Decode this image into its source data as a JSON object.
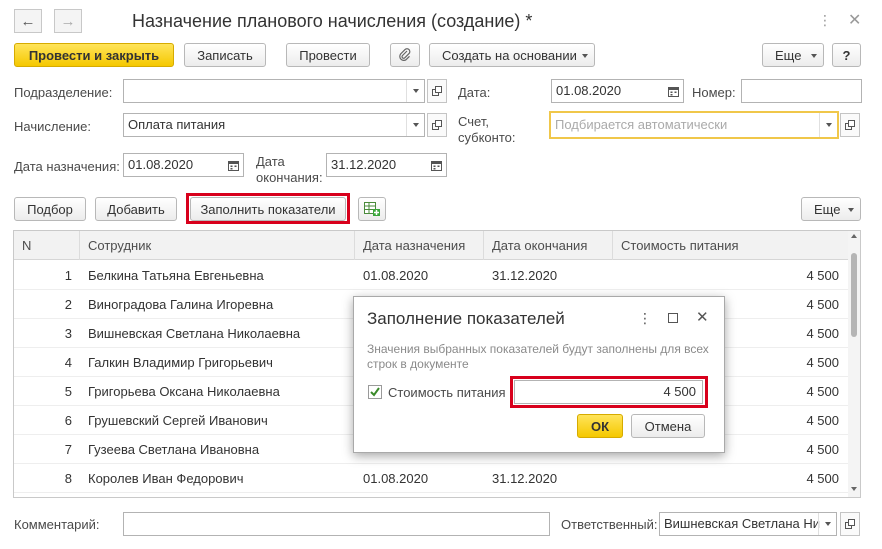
{
  "window": {
    "title": "Назначение планового начисления (создание) *"
  },
  "toolbar": {
    "post_close": "Провести и закрыть",
    "save": "Записать",
    "post": "Провести",
    "create_based": "Создать на основании",
    "more": "Еще",
    "help": "?"
  },
  "form": {
    "department_label": "Подразделение:",
    "department_value": "",
    "date_label": "Дата:",
    "date_value": "01.08.2020",
    "number_label": "Номер:",
    "number_value": "",
    "accrual_label": "Начисление:",
    "accrual_value": "Оплата питания",
    "account_label_1": "Счет,",
    "account_label_2": "субконто:",
    "account_placeholder": "Подбирается автоматически",
    "assign_date_label": "Дата назначения:",
    "assign_date_value": "01.08.2020",
    "end_date_label_1": "Дата",
    "end_date_label_2": "окончания:",
    "end_date_value": "31.12.2020"
  },
  "table_toolbar": {
    "pick": "Подбор",
    "add": "Добавить",
    "fill": "Заполнить показатели",
    "more": "Еще"
  },
  "table": {
    "columns": [
      "N",
      "Сотрудник",
      "Дата назначения",
      "Дата окончания",
      "Стоимость питания"
    ],
    "rows": [
      {
        "n": "1",
        "employee": "Белкина Татьяна Евгеньевна",
        "start": "01.08.2020",
        "end": "31.12.2020",
        "cost": "4 500"
      },
      {
        "n": "2",
        "employee": "Виноградова Галина Игоревна",
        "start": "",
        "end": "",
        "cost": "4 500"
      },
      {
        "n": "3",
        "employee": "Вишневская Светлана Николаевна",
        "start": "",
        "end": "",
        "cost": "4 500"
      },
      {
        "n": "4",
        "employee": "Галкин Владимир Григорьевич",
        "start": "",
        "end": "",
        "cost": "4 500"
      },
      {
        "n": "5",
        "employee": "Григорьева Оксана Николаевна",
        "start": "",
        "end": "",
        "cost": "4 500"
      },
      {
        "n": "6",
        "employee": "Грушевский Сергей Иванович",
        "start": "",
        "end": "",
        "cost": "4 500"
      },
      {
        "n": "7",
        "employee": "Гузеева Светлана Ивановна",
        "start": "",
        "end": "",
        "cost": "4 500"
      },
      {
        "n": "8",
        "employee": "Королев Иван Федорович",
        "start": "01.08.2020",
        "end": "31.12.2020",
        "cost": "4 500"
      }
    ]
  },
  "footer": {
    "comment_label": "Комментарий:",
    "comment_value": "",
    "responsible_label": "Ответственный:",
    "responsible_value": "Вишневская Светлана Ни"
  },
  "dialog": {
    "title": "Заполнение показателей",
    "description": "Значения выбранных показателей будут заполнены для всех строк в документе",
    "checkbox_label": "Стоимость питания",
    "checkbox_checked": true,
    "value": "4 500",
    "ok": "ОК",
    "cancel": "Отмена"
  },
  "colors": {
    "accent_yellow": "#f5c800",
    "highlight_red": "#d8001c"
  }
}
